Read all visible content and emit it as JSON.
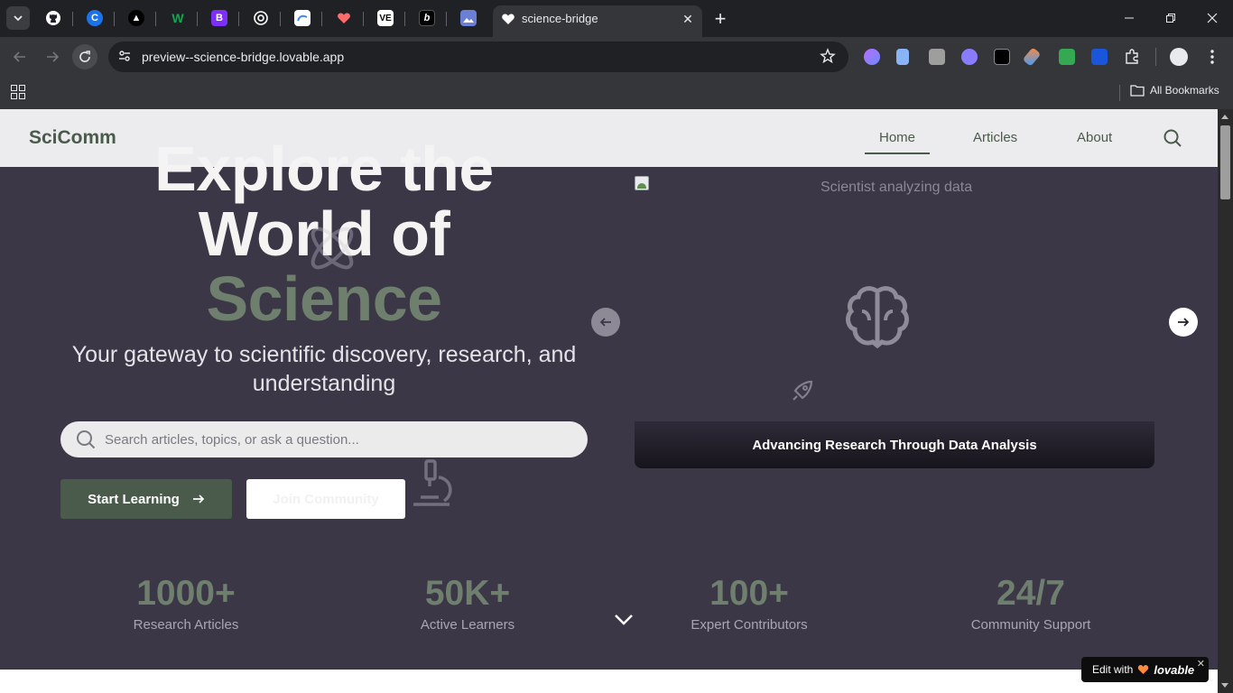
{
  "browser": {
    "active_tab_title": "science-bridge",
    "url": "preview--science-bridge.lovable.app",
    "all_bookmarks_label": "All Bookmarks",
    "tabs": [
      {
        "icon": "github-icon",
        "color": "#ffffff"
      },
      {
        "icon": "circle-c-icon",
        "color": "#1a73e8"
      },
      {
        "icon": "triangle-logo-icon",
        "color": "#000000"
      },
      {
        "icon": "w-logo-icon",
        "color": "#12a650"
      },
      {
        "icon": "b-logo-icon",
        "color": "#7b2ff7"
      },
      {
        "icon": "openai-icon",
        "color": "#ffffff"
      },
      {
        "icon": "app-icon",
        "color": "#4285f4"
      },
      {
        "icon": "heart-logo-icon",
        "color": "#ff6b6b"
      },
      {
        "icon": "vercel-icon",
        "color": "#ffffff"
      },
      {
        "icon": "b-logo-icon",
        "color": "#000000"
      },
      {
        "icon": "image-icon",
        "color": "#6b7fd7"
      }
    ]
  },
  "site": {
    "logo": "SciComm",
    "nav": {
      "home": "Home",
      "articles": "Articles",
      "about": "About"
    },
    "hero": {
      "title_line1": "Explore the",
      "title_line2": "World of",
      "title_line3": "Science",
      "subtitle": "Your gateway to scientific discovery, research, and understanding",
      "search_placeholder": "Search articles, topics, or ask a question...",
      "primary_button": "Start Learning",
      "secondary_button": "Join Community"
    },
    "carousel": {
      "image_alt": "Scientist analyzing data",
      "caption": "Advancing Research Through Data Analysis"
    },
    "stats": [
      {
        "value": "1000+",
        "label": "Research Articles"
      },
      {
        "value": "50K+",
        "label": "Active Learners"
      },
      {
        "value": "100+",
        "label": "Expert Contributors"
      },
      {
        "value": "24/7",
        "label": "Community Support"
      }
    ]
  },
  "badge": {
    "prefix": "Edit with",
    "brand": "lovable"
  },
  "colors": {
    "accent_green": "#4a5a4b",
    "hero_bg": "#3b3747",
    "science_text": "#6f7f6e"
  }
}
